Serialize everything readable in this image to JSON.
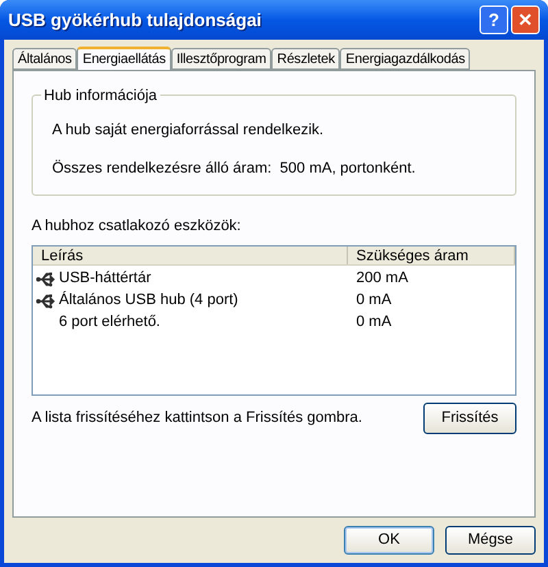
{
  "window": {
    "title": "USB gyökérhub tulajdonságai",
    "buttons": [
      "?",
      "✕"
    ]
  },
  "tabs": [
    {
      "label": "Általános",
      "selected": false
    },
    {
      "label": "Energiaellátás",
      "selected": true
    },
    {
      "label": "Illesztőprogram",
      "selected": false
    },
    {
      "label": "Részletek",
      "selected": false
    },
    {
      "label": "Energiagazdálkodás",
      "selected": false
    }
  ],
  "hub_info": {
    "title": "Hub információja",
    "lines": [
      "A hub saját energiaforrással rendelkezik.",
      "Összes rendelkezésre álló áram:  500 mA, portonként."
    ]
  },
  "devices": {
    "label": "A hubhoz csatlakozó eszközök:",
    "columns": [
      "Leírás",
      "Szükséges áram"
    ],
    "rows": [
      {
        "kind": "device",
        "name": "USB-háttértár",
        "current": "200 mA"
      },
      {
        "kind": "device",
        "name": "Általános USB hub (4 port)",
        "current": "0 mA"
      },
      {
        "kind": "info",
        "name": "6 port elérhető.",
        "current": "0 mA"
      }
    ]
  },
  "refresh": {
    "hint": "A lista frissítéséhez kattintson a Frissítés gombra.",
    "button": "Frissítés"
  },
  "buttons": [
    "OK",
    "Mégse"
  ]
}
